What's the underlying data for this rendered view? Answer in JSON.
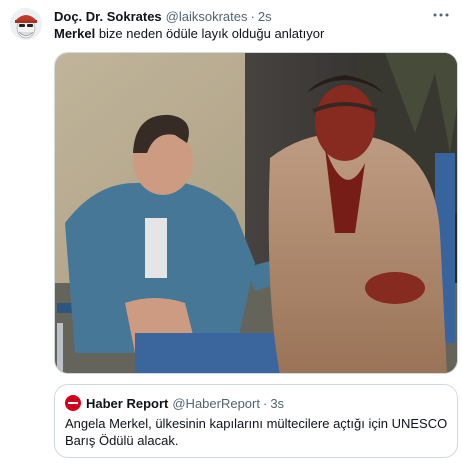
{
  "tweet": {
    "author_name": "Doç. Dr. Sokrates",
    "author_handle": "@laiksokrates",
    "separator": "·",
    "time": "2s",
    "text_bold": "Merkel",
    "text_rest": " bize neden ödüle layık olduğu anlatıyor",
    "more_icon": "more-horizontal-icon",
    "avatar_icon": "avatar-icon"
  },
  "media": {
    "description_icon": "photo"
  },
  "quote": {
    "author_name": "Haber Report",
    "author_handle": "@HaberReport",
    "separator": "·",
    "time": "3s",
    "text": "Angela Merkel, ülkesinin kapılarını mültecilere açtığı için UNESCO Barış Ödülü alacak.",
    "logo_color": "#d0021b"
  },
  "colors": {
    "text": "#0f1419",
    "secondary": "#536471",
    "border": "#cfd9de"
  }
}
